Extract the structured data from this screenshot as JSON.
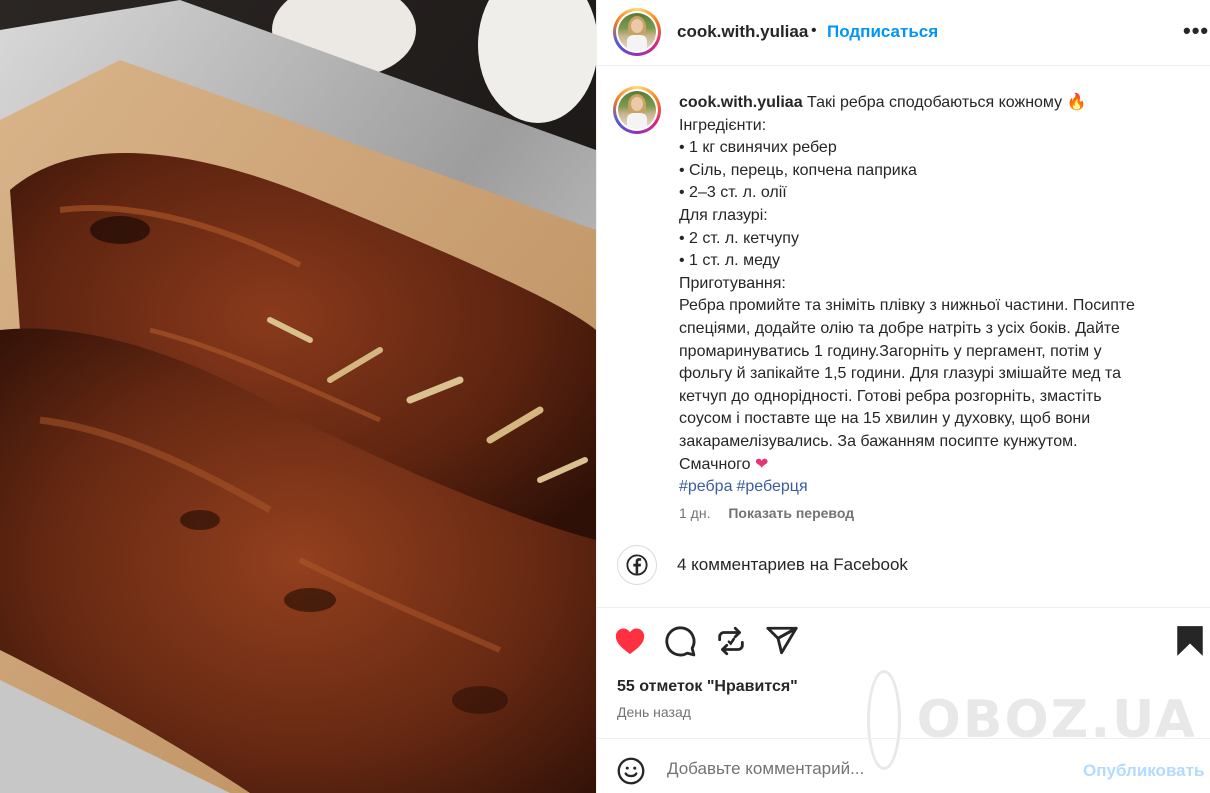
{
  "header": {
    "username": "cook.with.yuliaa",
    "separator": "•",
    "follow_label": "Подписаться",
    "more_label": "•••"
  },
  "caption": {
    "username": "cook.with.yuliaa",
    "lines": [
      "Такі ребра сподобаються кожному",
      "Інгредієнти:",
      "• 1 кг свинячих ребер",
      "• Сіль, перець, копчена паприка",
      "• 2–3 ст. л. олії",
      "Для глазурі:",
      "• 2 ст. л. кетчупу",
      "• 1 ст. л. меду",
      "Приготування:",
      "Ребра промийте та зніміть плівку з нижньої частини. Посипте",
      "спеціями, додайте олію та добре натріть з усіх боків. Дайте",
      "промаринуватись 1 годину.Загорніть у пергамент, потім у",
      "фольгу й запікайте 1,5 години. Для глазурі змішайте мед та",
      "кетчуп до однорідності. Готові ребра розгорніть, змастіть",
      "соусом і поставте ще на 15 хвилин у духовку, щоб вони",
      "закарамелізувались. За бажанням посипте кунжутом.",
      "Смачного"
    ],
    "first_line_emoji": "🔥",
    "last_line_emoji": "❤",
    "hashtags": [
      "#ребра",
      "#реберця"
    ],
    "time": "1 дн.",
    "translate_label": "Показать перевод"
  },
  "facebook": {
    "comments_label": "4 комментариев на Facebook"
  },
  "actions": {
    "liked": true,
    "like_color": "#ff3040",
    "saved": true
  },
  "likes_label": "55 отметок \"Нравится\"",
  "time_ago": "День назад",
  "watermark": "OBOZ.UA",
  "comment": {
    "placeholder": "Добавьте комментарий...",
    "publish_label": "Опубликовать"
  },
  "icons": {
    "like": "heart-icon",
    "comment": "comment-icon",
    "repost": "repost-icon",
    "share": "share-icon",
    "save": "bookmark-icon",
    "facebook": "facebook-icon",
    "emoji": "emoji-icon",
    "more": "more-icon"
  }
}
